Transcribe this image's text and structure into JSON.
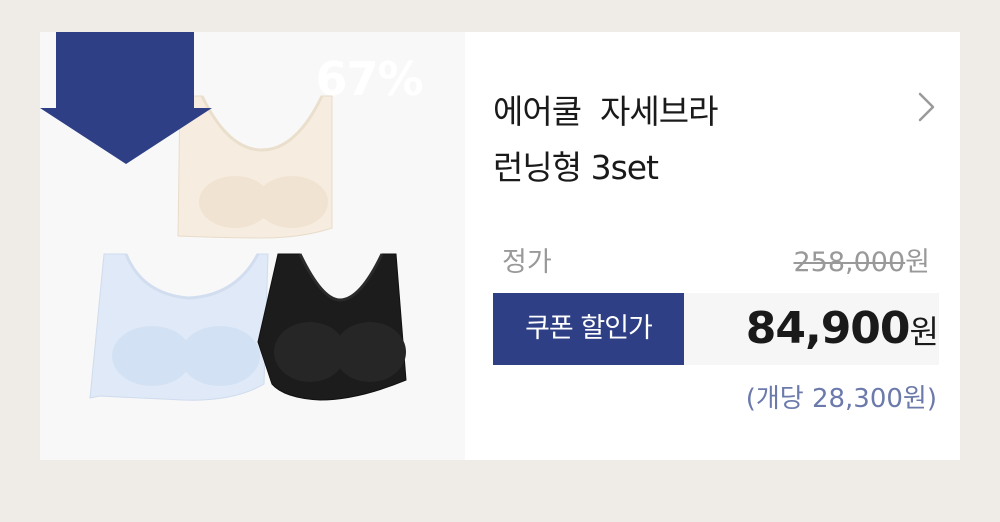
{
  "product": {
    "discount_badge": "67%",
    "title_line1": "에어쿨  자세브라",
    "title_line2": "런닝형 3set",
    "list_price_label": "정가",
    "list_price_value": "258,000",
    "list_price_unit": "원",
    "coupon_label": "쿠폰 할인가",
    "coupon_price_value": "84,900",
    "coupon_price_unit": "원",
    "per_unit_price": "(개당 28,300원)"
  },
  "colors": {
    "badge": "#2e3f86",
    "coupon_label_bg": "#2e3f86",
    "per_unit_text": "#6b7aab",
    "bra_cream": "#f6ecdf",
    "bra_light_blue": "#dfe9f7",
    "bra_black": "#1c1c1c"
  },
  "icons": {
    "chevron": "chevron-right-icon",
    "badge_arrow": "down-arrow-badge-icon"
  }
}
